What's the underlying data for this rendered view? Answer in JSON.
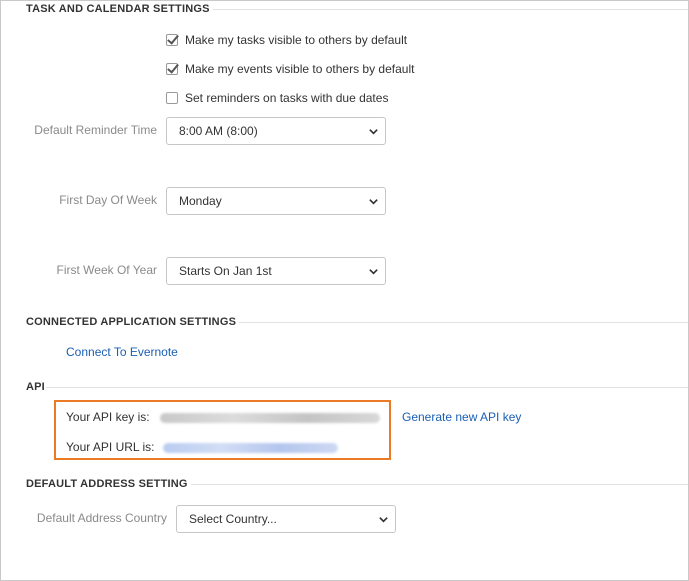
{
  "task_calendar": {
    "title": "TASK AND CALENDAR SETTINGS",
    "checkboxes": [
      {
        "label": "Make my tasks visible to others by default",
        "checked": true
      },
      {
        "label": "Make my events visible to others by default",
        "checked": true
      },
      {
        "label": "Set reminders on tasks with due dates",
        "checked": false
      }
    ],
    "default_reminder": {
      "label": "Default Reminder Time",
      "value": "8:00 AM (8:00)"
    },
    "first_day": {
      "label": "First Day Of Week",
      "value": "Monday"
    },
    "first_week": {
      "label": "First Week Of Year",
      "value": "Starts On Jan 1st"
    }
  },
  "connected_apps": {
    "title": "CONNECTED APPLICATION SETTINGS",
    "evernote_link": "Connect To Evernote"
  },
  "api": {
    "title": "API",
    "key_label": "Your API key is:",
    "url_label": "Your API URL is:",
    "generate_link": "Generate new API key"
  },
  "default_address": {
    "title": "DEFAULT ADDRESS SETTING",
    "country": {
      "label": "Default Address Country",
      "value": "Select Country..."
    }
  },
  "colors": {
    "highlight_border": "#ea7a23",
    "link": "#1a5fb4"
  }
}
